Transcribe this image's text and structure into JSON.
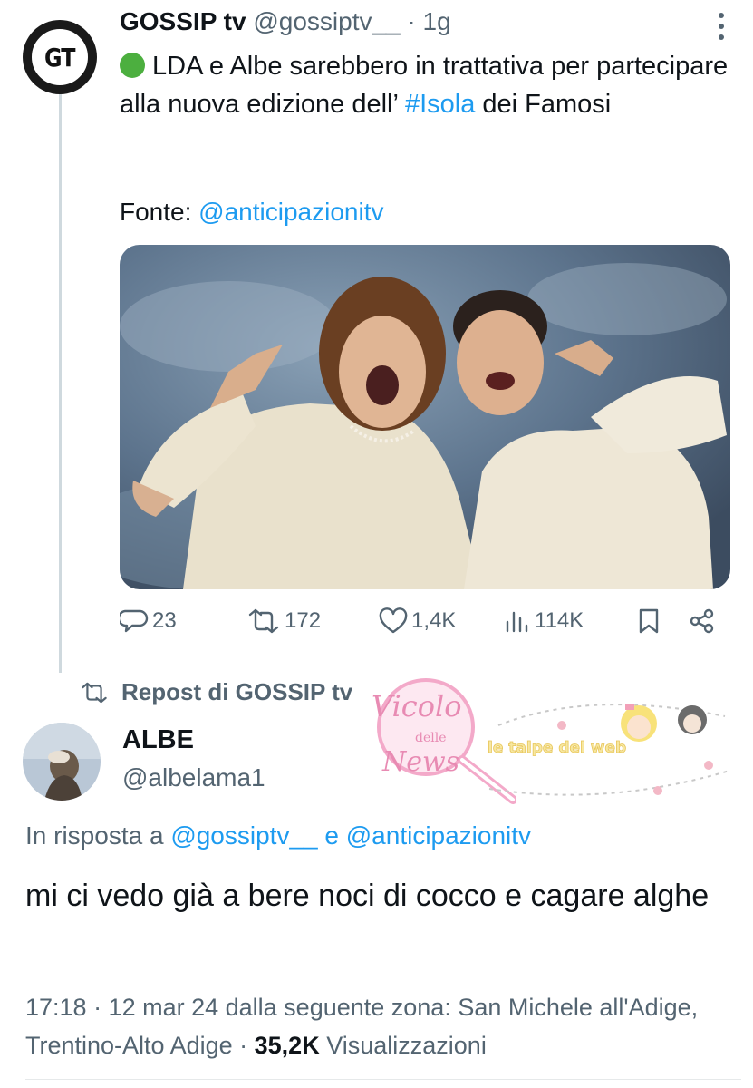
{
  "tweet": {
    "avatar_text": "GT",
    "author": "GOSSIP tv",
    "handle": "@gossiptv__",
    "dot": "·",
    "time": "1g",
    "text_part1": "LDA e Albe sarebbero in trattativa per partecipare alla nuova edizione dell’",
    "hashtag": "#Isola",
    "text_part2": " dei Famosi",
    "source_label": "Fonte:",
    "source_handle": "@anticipazionitv",
    "stats": {
      "replies": "23",
      "reposts": "172",
      "likes": "1,4K",
      "views": "114K"
    }
  },
  "repost": {
    "label": "Repost di GOSSIP tv"
  },
  "reply": {
    "author": "ALBE",
    "handle": "@albelama1",
    "in_reply_prefix": "In risposta a",
    "in_reply_handle1": "@gossiptv__",
    "in_reply_and": "e",
    "in_reply_handle2": "@anticipazionitv",
    "text": "mi ci vedo già a bere noci di cocco e cagare alghe",
    "meta_prefix": "17:18 · 12 mar 24 dalla seguente zona: San Michele all'Adige, Trentino-Alto Adige ·",
    "views_count": "35,2K",
    "views_label": "Visualizzazioni"
  },
  "watermarks": {
    "logo1_line1": "Vicolo",
    "logo1_line2": "delle",
    "logo1_line3": "News",
    "logo2_text": "le talpe del web"
  },
  "colors": {
    "link": "#1d9bf0",
    "secondary_text": "#536471",
    "primary_text": "#0f1419",
    "green_dot": "#4caf3f"
  }
}
